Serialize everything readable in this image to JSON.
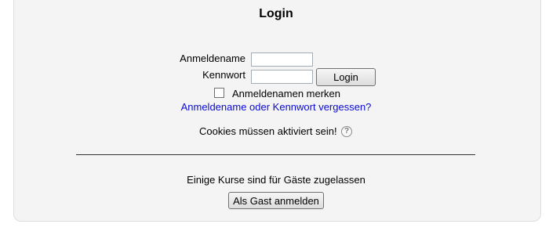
{
  "login": {
    "title": "Login",
    "username_label": "Anmeldename",
    "username_value": "",
    "password_label": "Kennwort",
    "password_value": "",
    "login_button": "Login",
    "remember_label": "Anmeldenamen merken",
    "remember_checked": false,
    "forgot_link": "Anmeldename oder Kennwort vergessen?",
    "cookies_notice": "Cookies müssen aktiviert sein!",
    "help_icon": "question-help-icon"
  },
  "guest": {
    "text": "Einige Kurse sind für Gäste zugelassen",
    "button": "Als Gast anmelden"
  },
  "colors": {
    "panel_bg": "#f4f4f4",
    "panel_border": "#dddddd",
    "link": "#0a0ad6"
  }
}
